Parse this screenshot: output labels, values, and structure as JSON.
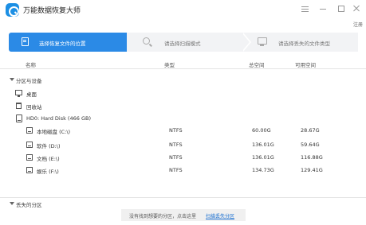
{
  "app": {
    "title": "万能数据恢复大师"
  },
  "header": {
    "register_label": "注册"
  },
  "steps": [
    {
      "label": "选择恢复文件的位置",
      "active": true,
      "icon": "document-icon"
    },
    {
      "label": "请选择扫描模式",
      "active": false,
      "icon": "search-icon"
    },
    {
      "label": "请选择丢失的文件类型",
      "active": false,
      "icon": "monitor-icon"
    }
  ],
  "table": {
    "columns": [
      "名称",
      "类型",
      "总空间",
      "可用空间"
    ],
    "section_title": "分区与设备",
    "special_items": [
      {
        "name": "桌面",
        "icon": "desktop-icon"
      },
      {
        "name": "回收站",
        "icon": "recycle-bin-icon"
      }
    ],
    "disk": {
      "name": "HD0: Hard Disk (466 GB)",
      "icon": "hard-disk-icon"
    },
    "partitions": [
      {
        "name": "本地磁盘 (C:\\)",
        "type": "NTFS",
        "total": "60.00G",
        "free": "28.67G"
      },
      {
        "name": "软件 (D:\\)",
        "type": "NTFS",
        "total": "136.01G",
        "free": "59.64G"
      },
      {
        "name": "文档 (E:\\)",
        "type": "NTFS",
        "total": "136.01G",
        "free": "116.88G"
      },
      {
        "name": "娱乐 (F:\\)",
        "type": "NTFS",
        "total": "134.73G",
        "free": "129.41G"
      }
    ]
  },
  "lost_section": {
    "title": "丢失的分区"
  },
  "footer": {
    "message": "没有找到想要的分区，点击这里",
    "link": "扫描丢失分区"
  },
  "colors": {
    "accent": "#2b8ae6",
    "inactive_step": "#f2f3f5",
    "link": "#1a6fd0"
  }
}
